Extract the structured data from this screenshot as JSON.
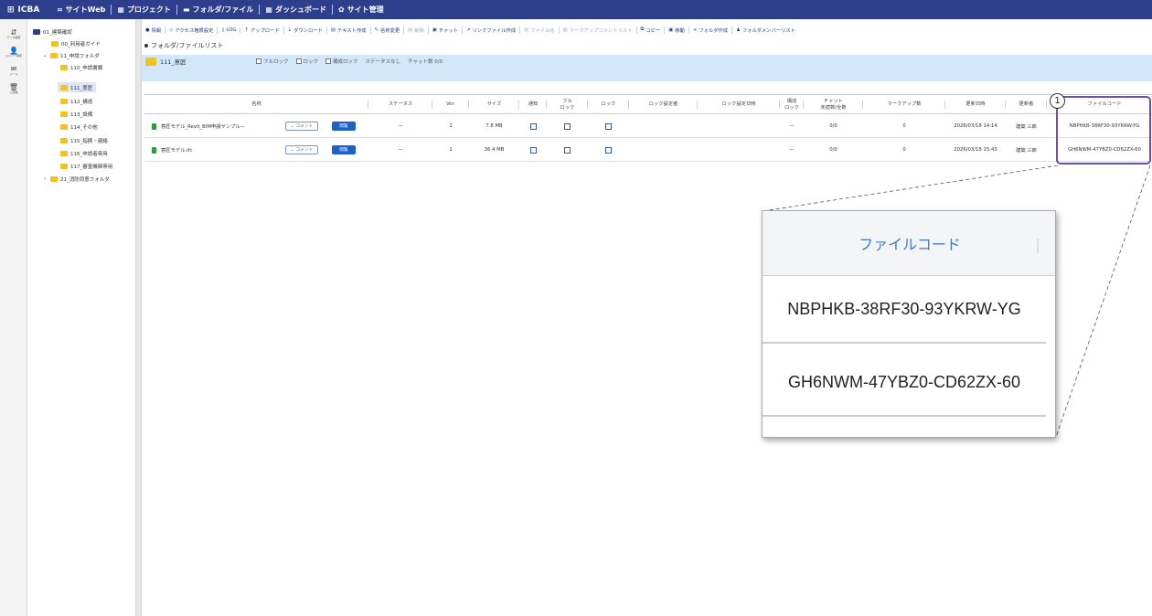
{
  "header": {
    "logo": "ICBA",
    "nav": [
      "サイトWeb",
      "プロジェクト",
      "フォルダ/ファイル",
      "ダッシュボード",
      "サイト管理"
    ]
  },
  "iconbar": [
    {
      "glyph": "⇵",
      "label": "データ検索"
    },
    {
      "glyph": "👤",
      "label": "メンバー検索"
    },
    {
      "glyph": "✉",
      "label": "メール"
    },
    {
      "glyph": "🗑",
      "label": "ごみ箱"
    }
  ],
  "tree": {
    "root": "01_建築確認",
    "items": [
      {
        "label": "00_利用者ガイド"
      },
      {
        "label": "11_申請フォルダ"
      },
      {
        "label": "110_申請書類"
      },
      {
        "label": "111_意匠"
      },
      {
        "label": "112_構造"
      },
      {
        "label": "113_設備"
      },
      {
        "label": "114_その他"
      },
      {
        "label": "115_指摘・連絡"
      },
      {
        "label": "116_申請者専用"
      },
      {
        "label": "117_審査機関専用"
      },
      {
        "label": "21_消防同意フォルダ"
      }
    ]
  },
  "toolbar": [
    {
      "icon": "●",
      "label": "情報"
    },
    {
      "icon": "◇",
      "label": "アクセス権限設定"
    },
    {
      "icon": "▯",
      "label": "LOG"
    },
    {
      "icon": "↑",
      "label": "アップロード"
    },
    {
      "icon": "↓",
      "label": "ダウンロード"
    },
    {
      "icon": "▤",
      "label": "テキスト作成"
    },
    {
      "icon": "✎",
      "label": "名称変更"
    },
    {
      "icon": "▤",
      "label": "削除"
    },
    {
      "icon": "▣",
      "label": "チャット"
    },
    {
      "icon": "↗",
      "label": "リンクファイル作成"
    },
    {
      "icon": "▤",
      "label": "ファイル化"
    },
    {
      "icon": "▥",
      "label": "マークアップコメントリスト"
    },
    {
      "icon": "⧉",
      "label": "コピー"
    },
    {
      "icon": "▣",
      "label": "移動"
    },
    {
      "icon": "+",
      "label": "フォルダ作成"
    },
    {
      "icon": "♟",
      "label": "フォルダメンバーリスト"
    }
  ],
  "list_title": "フォルダ/ファイルリスト",
  "folder_band": {
    "name": "111_意匠",
    "full_lock": "フルロック",
    "lock": "ロック",
    "config_lock": "構成ロック",
    "status": "ステータスなし",
    "chat": "チャット数 0/0"
  },
  "table": {
    "columns": {
      "name": "名称",
      "status": "ステータス",
      "ver": "Ver.",
      "size": "サイズ",
      "notify": "通知",
      "full_lock": "フル\nロック",
      "lock": "ロック",
      "lock_setter": "ロック設定者",
      "lock_date": "ロック設定日時",
      "config_lock": "構成\nロック",
      "chat": "チャット\n未読数/全数",
      "markup": "マークアップ数",
      "updated": "更新日時",
      "updater": "更新者",
      "file_code": "ファイルコード"
    },
    "comment_label": "コメント",
    "view_label": "閲覧",
    "rows": [
      {
        "name": "意匠モデル_Revit_BIM申請サンプル—",
        "status": "—",
        "ver": "1",
        "size": "7.8 MB",
        "config_lock": "—",
        "chat": "0/0",
        "markup": "0",
        "updated": "2026/03/18 14:14",
        "updater": "建築 三郎",
        "file_code": "NBPHKB-38RF30-93YKRW-YG"
      },
      {
        "name": "意匠モデル.ifc",
        "status": "—",
        "ver": "1",
        "size": "36.4 MB",
        "config_lock": "—",
        "chat": "0/0",
        "markup": "0",
        "updated": "2026/03/18 15:43",
        "updater": "建築 三郎",
        "file_code": "GH6NWM-47YBZ0-CD62ZX-60"
      }
    ]
  },
  "callout": {
    "number": "1",
    "zoom_header": "ファイルコード",
    "zoom_codes": [
      "NBPHKB-38RF30-93YKRW-YG",
      "GH6NWM-47YBZ0-CD62ZX-60"
    ]
  }
}
